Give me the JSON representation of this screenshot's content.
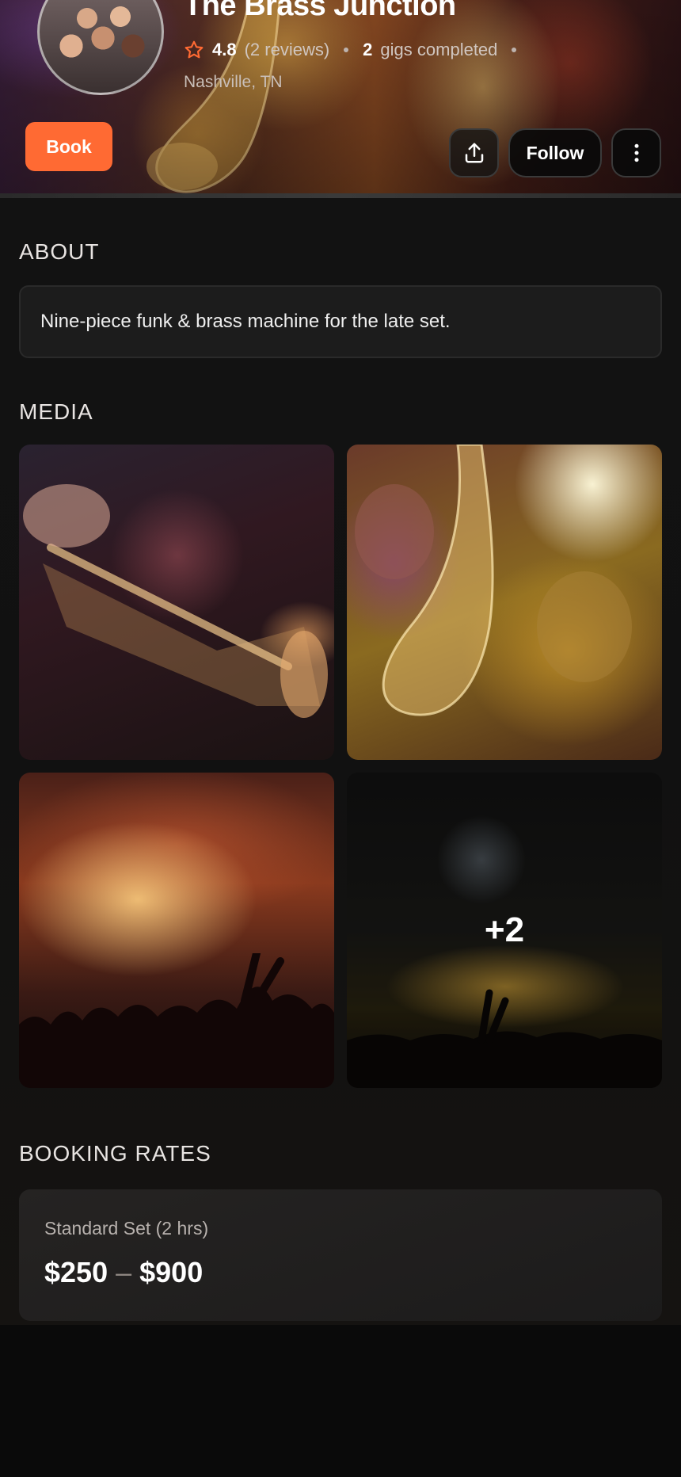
{
  "artist": {
    "name": "The Brass Junction",
    "rating": "4.8",
    "reviews": "(2 reviews)",
    "gigs_count": "2",
    "gigs_label": "gigs completed",
    "location": "Nashville, TN"
  },
  "actions": {
    "book_label": "Book",
    "follow_label": "Follow"
  },
  "about": {
    "title": "ABOUT",
    "text": "Nine-piece funk & brass machine for the late set."
  },
  "media": {
    "title": "MEDIA",
    "more_count": "+2"
  },
  "booking_rates": {
    "title": "BOOKING RATES",
    "items": [
      {
        "name": "Standard Set (2 hrs)",
        "min": "$250",
        "separator": "–",
        "max": "$900"
      }
    ]
  },
  "colors": {
    "accent": "#ff6a33",
    "background": "#0a0a0a",
    "card": "#1c1c1c"
  },
  "icons": [
    "star-icon",
    "share-icon",
    "more-vertical-icon"
  ]
}
